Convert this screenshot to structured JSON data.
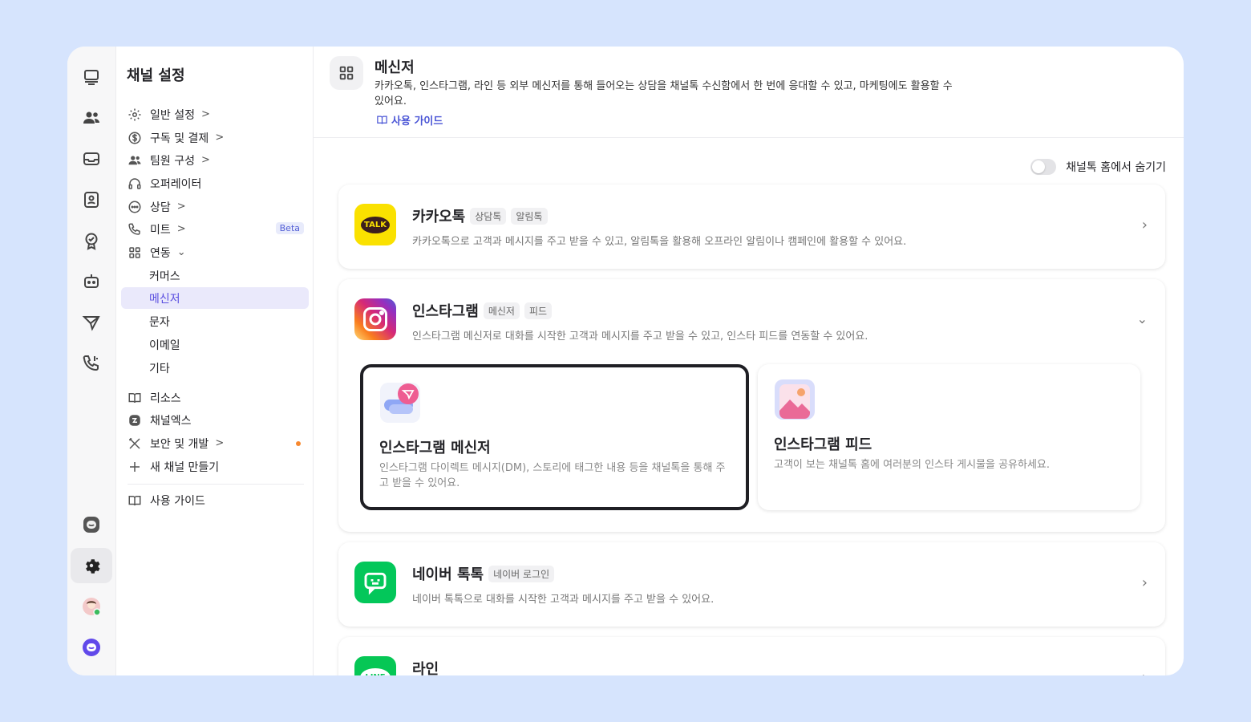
{
  "menu": {
    "title": "채널 설정",
    "items": [
      {
        "label": "일반 설정",
        "icon": "gear-icon"
      },
      {
        "label": "구독 및 결제",
        "icon": "dollar-icon"
      },
      {
        "label": "팀원 구성",
        "icon": "people-icon"
      },
      {
        "label": "오퍼레이터",
        "icon": "headset-icon"
      },
      {
        "label": "상담",
        "icon": "chat-dots-icon"
      },
      {
        "label": "미트",
        "icon": "phone-icon",
        "badge": "Beta"
      },
      {
        "label": "연동",
        "icon": "grid-icon"
      }
    ],
    "sub_items": [
      {
        "label": "커머스"
      },
      {
        "label": "메신저",
        "selected": true
      },
      {
        "label": "문자"
      },
      {
        "label": "이메일"
      },
      {
        "label": "기타"
      }
    ],
    "items2": [
      {
        "label": "리소스",
        "icon": "book-icon"
      },
      {
        "label": "채널엑스",
        "icon": "channelx-icon"
      },
      {
        "label": "보안 및 개발",
        "icon": "tools-icon"
      },
      {
        "label": "새 채널 만들기",
        "icon": "plus-icon"
      }
    ],
    "guide_label": "사용 가이드"
  },
  "header": {
    "title": "메신저",
    "description": "카카오톡, 인스타그램, 라인 등 외부 메신저를 통해 들어오는 상담을 채널톡 수신함에서 한 번에 응대할 수 있고, 마케팅에도 활용할 수 있어요.",
    "guide_link": "사용 가이드"
  },
  "hide_toggle_label": "채널톡 홈에서 숨기기",
  "cards": {
    "kakao": {
      "name": "카카오톡",
      "tags": [
        "상담톡",
        "알림톡"
      ],
      "desc": "카카오톡으로 고객과 메시지를 주고 받을 수 있고, 알림톡을 활용해 오프라인 알림이나 캠페인에 활용할 수 있어요.",
      "logo_text": "TALK"
    },
    "instagram": {
      "name": "인스타그램",
      "tags": [
        "메신저",
        "피드"
      ],
      "desc": "인스타그램 메신저로 대화를 시작한 고객과 메시지를 주고 받을 수 있고, 인스타 피드를 연동할 수 있어요.",
      "messenger": {
        "title": "인스타그램 메신저",
        "desc": "인스타그램 다이렉트 메시지(DM), 스토리에 태그한 내용 등을 채널톡을 통해 주고 받을 수 있어요."
      },
      "feed": {
        "title": "인스타그램 피드",
        "desc": "고객이 보는 채널톡 홈에 여러분의 인스타 게시물을 공유하세요."
      }
    },
    "naver": {
      "name": "네이버 톡톡",
      "tags": [
        "네이버 로그인"
      ],
      "desc": "네이버 톡톡으로 대화를 시작한 고객과 메시지를 주고 받을 수 있어요."
    },
    "line": {
      "name": "라인",
      "logo_text": "LINE"
    }
  },
  "colors": {
    "accent": "#5b4fe0",
    "kakao": "#fae100",
    "naver": "#03c75a",
    "line": "#06c755"
  }
}
